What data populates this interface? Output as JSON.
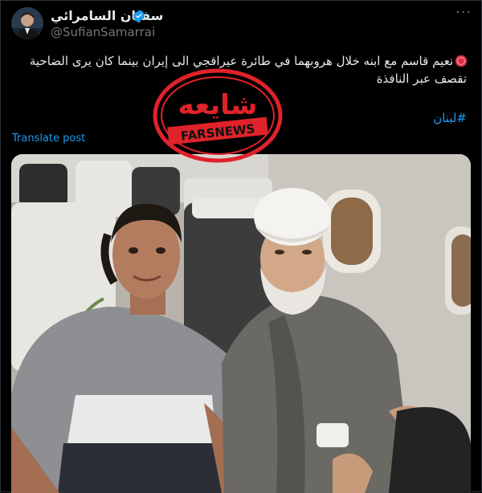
{
  "author": {
    "display_name": "سفيان السامرائي",
    "handle": "@SufianSamarrai",
    "verified": true
  },
  "post": {
    "text": "نعيم قاسم مع ابنه خلال هروبهما في طائرة عيراقجي الى إيران بينما كان يرى الضاحية تقصف عبر النافذة",
    "hashtag": "#لبنان",
    "translate_label": "Translate post"
  },
  "watermark": {
    "word": "شايعه",
    "brand": "FARSNEWS"
  },
  "icons": {
    "more": "more-horizontal-icon",
    "verified": "verified-badge-icon",
    "stop": "red-circle-emoji-icon"
  },
  "colors": {
    "background": "#000000",
    "link": "#1d9bf0",
    "muted": "#71767b",
    "text": "#e7e9ea",
    "stamp": "#e0222a"
  }
}
